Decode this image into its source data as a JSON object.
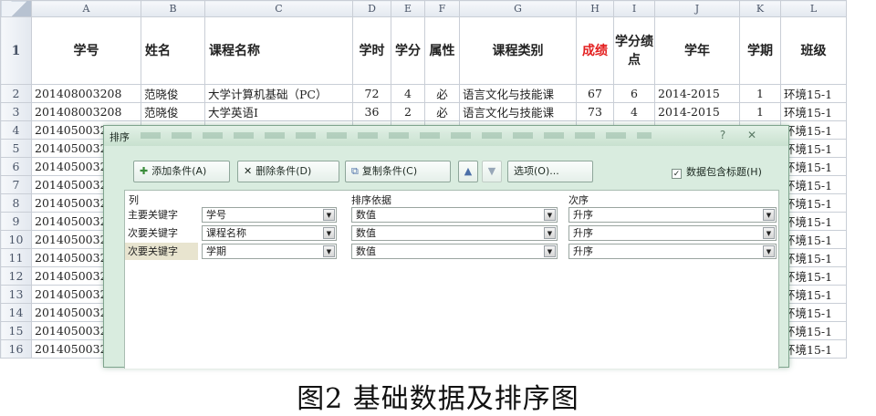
{
  "columns": [
    "A",
    "B",
    "C",
    "D",
    "E",
    "F",
    "G",
    "H",
    "I",
    "J",
    "K",
    "L"
  ],
  "header_row": {
    "row_number": "1",
    "cells": [
      "学号",
      "姓名",
      "课程名称",
      "学时",
      "学分",
      "属性",
      "课程类别",
      "成绩",
      "学分绩点",
      "学年",
      "学期",
      "班级"
    ]
  },
  "rows": [
    {
      "n": "2",
      "cells": [
        "201408003208",
        "范晓俊",
        "大学计算机基础（PC）",
        "72",
        "4",
        "必",
        "语言文化与技能课",
        "67",
        "6",
        "2014-2015",
        "1",
        "环境15-1"
      ]
    },
    {
      "n": "3",
      "cells": [
        "201408003208",
        "范晓俊",
        "大学英语Ⅰ",
        "36",
        "2",
        "必",
        "语言文化与技能课",
        "73",
        "4",
        "2014-2015",
        "1",
        "环境15-1"
      ]
    },
    {
      "n": "4",
      "cells": [
        "20140500320",
        "",
        "",
        "",
        "",
        "",
        "",
        "",
        "",
        "",
        "",
        "环境15-1"
      ]
    },
    {
      "n": "5",
      "cells": [
        "20140500320",
        "",
        "",
        "",
        "",
        "",
        "",
        "",
        "",
        "",
        "",
        "环境15-1"
      ]
    },
    {
      "n": "6",
      "cells": [
        "20140500320",
        "",
        "",
        "",
        "",
        "",
        "",
        "",
        "",
        "",
        "",
        "环境15-1"
      ]
    },
    {
      "n": "7",
      "cells": [
        "20140500320",
        "",
        "",
        "",
        "",
        "",
        "",
        "",
        "",
        "",
        "",
        "环境15-1"
      ]
    },
    {
      "n": "8",
      "cells": [
        "20140500320",
        "",
        "",
        "",
        "",
        "",
        "",
        "",
        "",
        "",
        "",
        "环境15-1"
      ]
    },
    {
      "n": "9",
      "cells": [
        "20140500320",
        "",
        "",
        "",
        "",
        "",
        "",
        "",
        "",
        "",
        "",
        "环境15-1"
      ]
    },
    {
      "n": "10",
      "cells": [
        "20140500320",
        "",
        "",
        "",
        "",
        "",
        "",
        "",
        "",
        "",
        "",
        "环境15-1"
      ]
    },
    {
      "n": "11",
      "cells": [
        "20140500320",
        "",
        "",
        "",
        "",
        "",
        "",
        "",
        "",
        "",
        "",
        "环境15-1"
      ]
    },
    {
      "n": "12",
      "cells": [
        "20140500320",
        "",
        "",
        "",
        "",
        "",
        "",
        "",
        "",
        "",
        "",
        "环境15-1"
      ]
    },
    {
      "n": "13",
      "cells": [
        "20140500320",
        "",
        "",
        "",
        "",
        "",
        "",
        "",
        "",
        "",
        "",
        "环境15-1"
      ]
    },
    {
      "n": "14",
      "cells": [
        "20140500320",
        "",
        "",
        "",
        "",
        "",
        "",
        "",
        "",
        "",
        "",
        "环境15-1"
      ]
    },
    {
      "n": "15",
      "cells": [
        "20140500320",
        "",
        "",
        "",
        "",
        "",
        "",
        "",
        "",
        "",
        "",
        "环境15-1"
      ]
    },
    {
      "n": "16",
      "cells": [
        "20140500320",
        "",
        "",
        "",
        "",
        "",
        "",
        "",
        "",
        "",
        "",
        "环境15-1"
      ]
    }
  ],
  "dialog": {
    "title": "排序",
    "buttons": {
      "add": "添加条件(A)",
      "delete": "删除条件(D)",
      "copy": "复制条件(C)",
      "up": "▲",
      "down": "▼",
      "options": "选项(O)..."
    },
    "has_header_label": "数据包含标题(H)",
    "has_header_checked": true,
    "grid_headers": {
      "column": "列",
      "basis": "排序依据",
      "order": "次序"
    },
    "sort_levels": [
      {
        "label": "主要关键字",
        "column": "学号",
        "basis": "数值",
        "order": "升序"
      },
      {
        "label": "次要关键字",
        "column": "课程名称",
        "basis": "数值",
        "order": "升序"
      },
      {
        "label": "次要关键字",
        "column": "学期",
        "basis": "数值",
        "order": "升序"
      }
    ]
  },
  "caption": "图2  基础数据及排序图",
  "colors": {
    "highlight_header": "#e31f1f",
    "dialog_bg": "#d9ecdf",
    "selected_row": "#e8e4cf"
  }
}
